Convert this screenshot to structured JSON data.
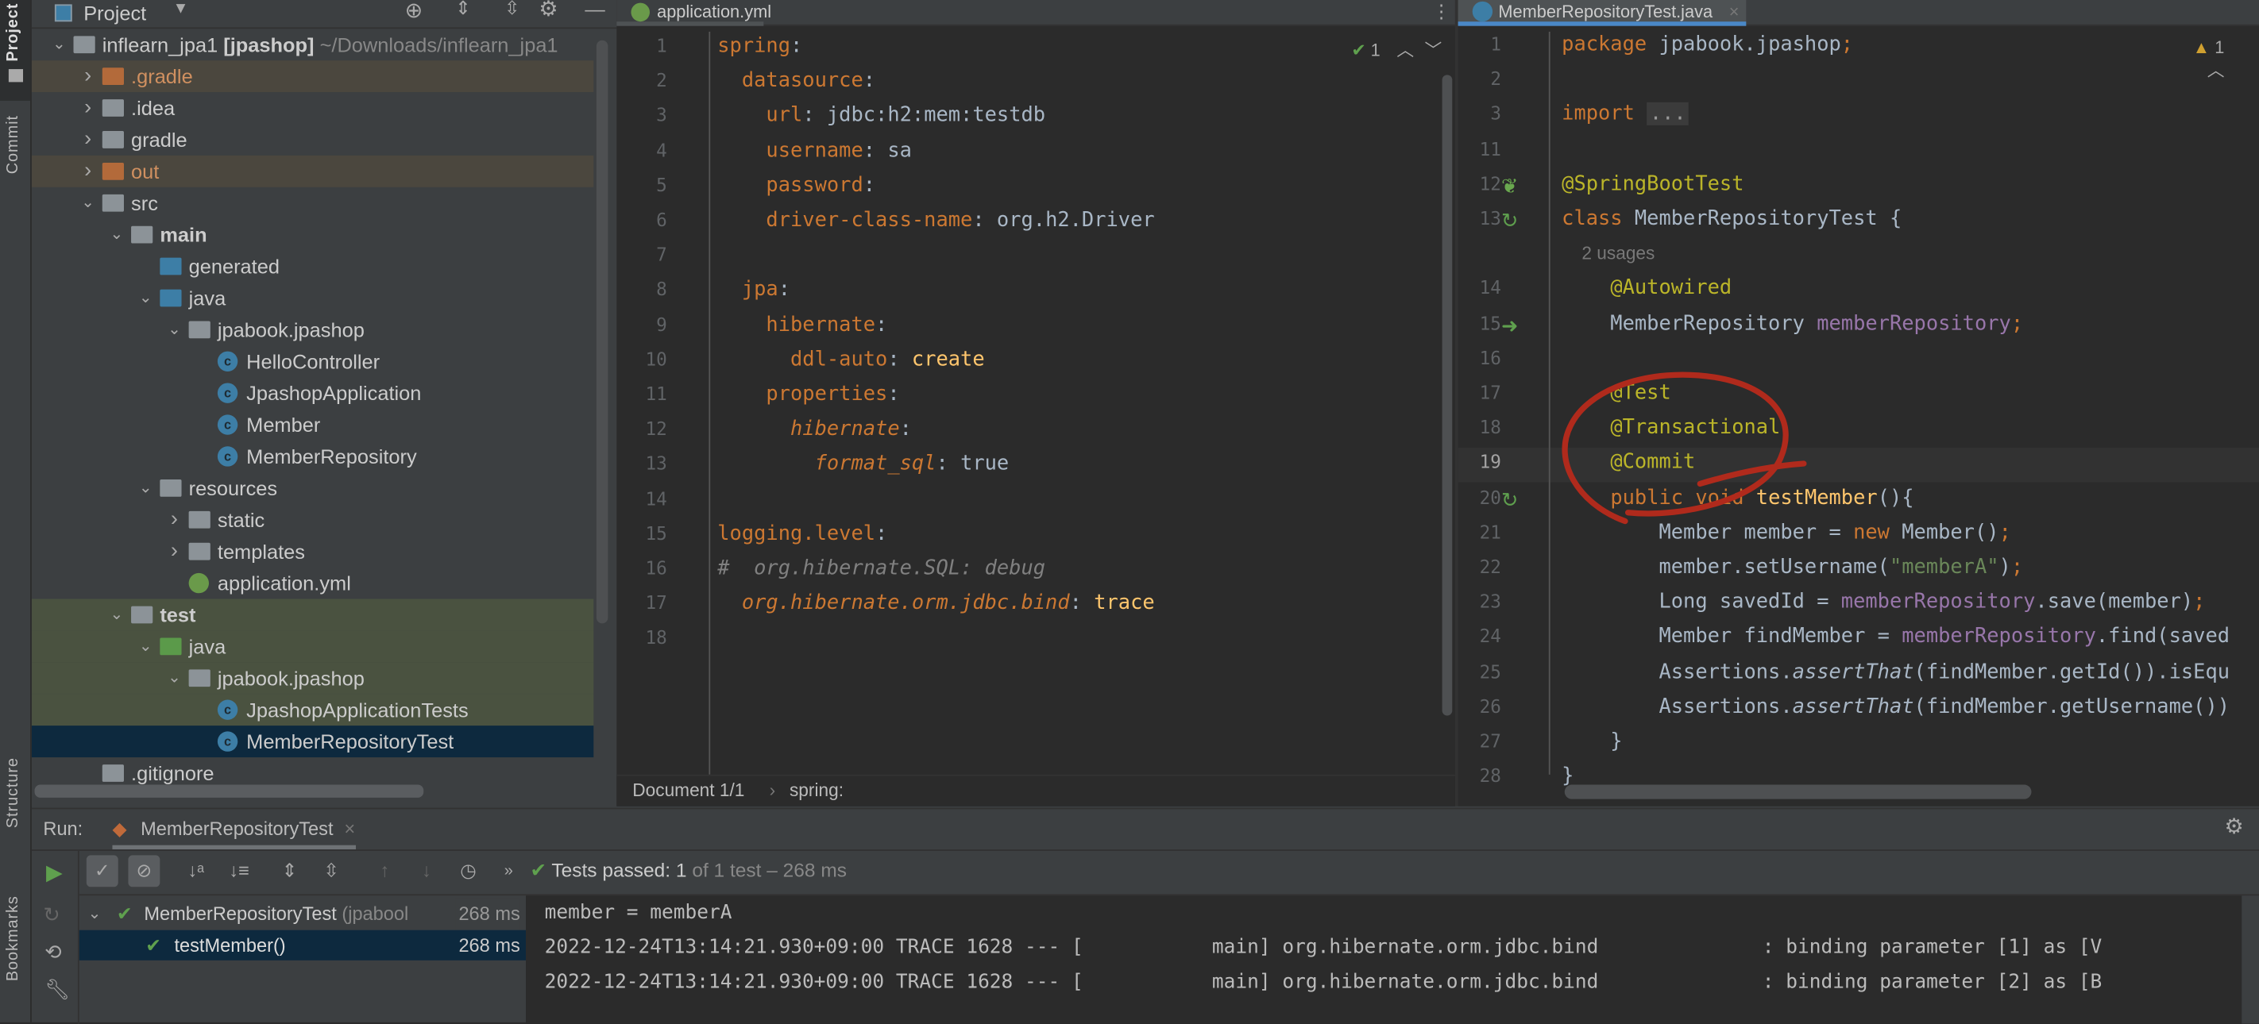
{
  "left_stripe": {
    "project": "Project",
    "commit": "Commit",
    "structure": "Structure",
    "bookmarks": "Bookmarks"
  },
  "project_panel": {
    "title": "Project",
    "tree": [
      {
        "label": "inflearn_jpa1",
        "bold_suffix": " [jpashop]",
        "path": "~/Downloads/inflearn_jpa1",
        "depth": 0,
        "arrow": "down",
        "icon": "module-folder"
      },
      {
        "label": ".gradle",
        "depth": 1,
        "arrow": "right",
        "icon": "excluded-folder",
        "highlight": "excluded"
      },
      {
        "label": ".idea",
        "depth": 1,
        "arrow": "right",
        "icon": "folder"
      },
      {
        "label": "gradle",
        "depth": 1,
        "arrow": "right",
        "icon": "folder"
      },
      {
        "label": "out",
        "depth": 1,
        "arrow": "right",
        "icon": "excluded-folder",
        "highlight": "excluded"
      },
      {
        "label": "src",
        "depth": 1,
        "arrow": "down",
        "icon": "folder"
      },
      {
        "label": "main",
        "depth": 2,
        "arrow": "down",
        "icon": "module-folder",
        "bold": true
      },
      {
        "label": "generated",
        "depth": 3,
        "arrow": "",
        "icon": "generated-folder"
      },
      {
        "label": "java",
        "depth": 3,
        "arrow": "down",
        "icon": "source-folder"
      },
      {
        "label": "jpabook.jpashop",
        "depth": 4,
        "arrow": "down",
        "icon": "package"
      },
      {
        "label": "HelloController",
        "depth": 5,
        "arrow": "",
        "icon": "class"
      },
      {
        "label": "JpashopApplication",
        "depth": 5,
        "arrow": "",
        "icon": "spring-class"
      },
      {
        "label": "Member",
        "depth": 5,
        "arrow": "",
        "icon": "class"
      },
      {
        "label": "MemberRepository",
        "depth": 5,
        "arrow": "",
        "icon": "class"
      },
      {
        "label": "resources",
        "depth": 3,
        "arrow": "down",
        "icon": "resources-folder"
      },
      {
        "label": "static",
        "depth": 4,
        "arrow": "right",
        "icon": "folder"
      },
      {
        "label": "templates",
        "depth": 4,
        "arrow": "right",
        "icon": "folder"
      },
      {
        "label": "application.yml",
        "depth": 4,
        "arrow": "",
        "icon": "yaml-file"
      },
      {
        "label": "test",
        "depth": 2,
        "arrow": "down",
        "icon": "module-folder",
        "bold": true,
        "highlight": "test"
      },
      {
        "label": "java",
        "depth": 3,
        "arrow": "down",
        "icon": "test-folder",
        "highlight": "test"
      },
      {
        "label": "jpabook.jpashop",
        "depth": 4,
        "arrow": "down",
        "icon": "package",
        "highlight": "test"
      },
      {
        "label": "JpashopApplicationTests",
        "depth": 5,
        "arrow": "",
        "icon": "test-class",
        "highlight": "test"
      },
      {
        "label": "MemberRepositoryTest",
        "depth": 5,
        "arrow": "",
        "icon": "test-class",
        "highlight": "selected"
      },
      {
        "label": ".gitignore",
        "depth": 1,
        "arrow": "",
        "icon": "ignore-file"
      }
    ]
  },
  "yaml_editor": {
    "tab": "application.yml",
    "inspection": "1",
    "breadcrumb": [
      "Document 1/1",
      "spring:"
    ],
    "lines": [
      [
        [
          "yk",
          "spring"
        ],
        [
          "yv",
          ":"
        ]
      ],
      [
        [
          "yv",
          "  "
        ],
        [
          "yk",
          "datasource"
        ],
        [
          "yv",
          ":"
        ]
      ],
      [
        [
          "yv",
          "    "
        ],
        [
          "yk",
          "url"
        ],
        [
          "yv",
          ": jdbc:h2:mem:testdb"
        ]
      ],
      [
        [
          "yv",
          "    "
        ],
        [
          "yk",
          "username"
        ],
        [
          "yv",
          ": sa"
        ]
      ],
      [
        [
          "yv",
          "    "
        ],
        [
          "yk",
          "password"
        ],
        [
          "yv",
          ":"
        ]
      ],
      [
        [
          "yv",
          "    "
        ],
        [
          "yk",
          "driver-class-name"
        ],
        [
          "yv",
          ": org.h2.Driver"
        ]
      ],
      [],
      [
        [
          "yv",
          "  "
        ],
        [
          "yk",
          "jpa"
        ],
        [
          "yv",
          ":"
        ]
      ],
      [
        [
          "yv",
          "    "
        ],
        [
          "yk",
          "hibernate"
        ],
        [
          "yv",
          ":"
        ]
      ],
      [
        [
          "yv",
          "      "
        ],
        [
          "yk",
          "ddl-auto"
        ],
        [
          "yv",
          ": "
        ],
        [
          "fn",
          "create"
        ]
      ],
      [
        [
          "yv",
          "    "
        ],
        [
          "yk",
          "properties"
        ],
        [
          "yv",
          ":"
        ]
      ],
      [
        [
          "yv",
          "      "
        ],
        [
          "yk it",
          "hibernate"
        ],
        [
          "yv",
          ":"
        ]
      ],
      [
        [
          "yv",
          "        "
        ],
        [
          "yk it",
          "format_sql"
        ],
        [
          "yv",
          ": true"
        ]
      ],
      [],
      [
        [
          "yk",
          "logging.level"
        ],
        [
          "yv",
          ":"
        ]
      ],
      [
        [
          "cm",
          "#  org.hibernate.SQL: debug"
        ]
      ],
      [
        [
          "yv",
          "  "
        ],
        [
          "yk it",
          "org.hibernate.orm.jdbc.bind"
        ],
        [
          "yv",
          ": "
        ],
        [
          "fn",
          "trace"
        ]
      ],
      []
    ]
  },
  "java_editor": {
    "tab": "MemberRepositoryTest.java",
    "warnings": "1",
    "lines": [
      {
        "n": "1",
        "t": [
          [
            "kw",
            "package "
          ],
          [
            "",
            "jpabook.jpashop"
          ],
          [
            "kw",
            ";"
          ]
        ]
      },
      {
        "n": "2",
        "t": []
      },
      {
        "n": "3",
        "t": [
          [
            "kw",
            "import "
          ],
          [
            "fold",
            "..."
          ]
        ]
      },
      {
        "n": "11",
        "t": []
      },
      {
        "n": "12",
        "t": [
          [
            "an",
            "@SpringBootTest"
          ]
        ],
        "g": "spring"
      },
      {
        "n": "13",
        "t": [
          [
            "kw",
            "class "
          ],
          [
            "",
            "MemberRepositoryTest {"
          ]
        ],
        "g": "run"
      },
      {
        "n": "",
        "t": [
          [
            "hint",
            "    2 usages"
          ]
        ]
      },
      {
        "n": "14",
        "t": [
          [
            "",
            "    "
          ],
          [
            "an",
            "@Autowired"
          ]
        ]
      },
      {
        "n": "15",
        "t": [
          [
            "",
            "    MemberRepository "
          ],
          [
            "fld",
            "memberRepository"
          ],
          [
            "kw",
            ";"
          ]
        ],
        "g": "bean"
      },
      {
        "n": "16",
        "t": []
      },
      {
        "n": "17",
        "t": [
          [
            "",
            "    "
          ],
          [
            "an",
            "@Test"
          ]
        ]
      },
      {
        "n": "18",
        "t": [
          [
            "",
            "    "
          ],
          [
            "an",
            "@Transactional"
          ]
        ]
      },
      {
        "n": "19",
        "t": [
          [
            "",
            "    "
          ],
          [
            "an",
            "@Commit"
          ]
        ],
        "current": true
      },
      {
        "n": "20",
        "t": [
          [
            "",
            "    "
          ],
          [
            "kw",
            "public void "
          ],
          [
            "fn",
            "testMember"
          ],
          [
            "",
            "(){"
          ]
        ],
        "g": "run"
      },
      {
        "n": "21",
        "t": [
          [
            "",
            "        Member member = "
          ],
          [
            "kw",
            "new "
          ],
          [
            "",
            "Member()"
          ],
          [
            "kw",
            ";"
          ]
        ]
      },
      {
        "n": "22",
        "t": [
          [
            "",
            "        member.setUsername("
          ],
          [
            "str",
            "\"memberA\""
          ],
          [
            "",
            ")"
          ],
          [
            "kw",
            ";"
          ]
        ]
      },
      {
        "n": "23",
        "t": [
          [
            "",
            "        Long savedId = "
          ],
          [
            "fld",
            "memberRepository"
          ],
          [
            "",
            ".save(member)"
          ],
          [
            "kw",
            ";"
          ]
        ]
      },
      {
        "n": "24",
        "t": [
          [
            "",
            "        Member findMember = "
          ],
          [
            "fld",
            "memberRepository"
          ],
          [
            "",
            ".find(saved"
          ]
        ]
      },
      {
        "n": "25",
        "t": [
          [
            "",
            "        Assertions."
          ],
          [
            "it",
            "assertThat"
          ],
          [
            "",
            "(findMember.getId()).isEqu"
          ]
        ]
      },
      {
        "n": "26",
        "t": [
          [
            "",
            "        Assertions."
          ],
          [
            "it",
            "assertThat"
          ],
          [
            "",
            "(findMember.getUsername())"
          ]
        ]
      },
      {
        "n": "27",
        "t": [
          [
            "",
            "    }"
          ]
        ]
      },
      {
        "n": "28",
        "t": [
          [
            "",
            "}"
          ]
        ]
      }
    ]
  },
  "run_panel": {
    "label": "Run:",
    "tab": "MemberRepositoryTest",
    "status_prefix": "Tests passed: ",
    "status_count": "1",
    "status_suffix": " of 1 test – 268 ms",
    "tree": [
      {
        "name": "MemberRepositoryTest",
        "detail": " (jpabool",
        "time": "268 ms"
      },
      {
        "name": "testMember()",
        "time": "268 ms"
      }
    ],
    "console": [
      "member = memberA",
      "2022-12-24T13:14:21.930+09:00 TRACE 1628 --- [           main] org.hibernate.orm.jdbc.bind              : binding parameter [1] as [V",
      "2022-12-24T13:14:21.930+09:00 TRACE 1628 --- [           main] org.hibernate.orm.jdbc.bind              : binding parameter [2] as [B"
    ]
  },
  "colors": {
    "annotation_circle": "#b02a1c",
    "accent": "#4a88c7",
    "pass": "#5fa04e"
  }
}
